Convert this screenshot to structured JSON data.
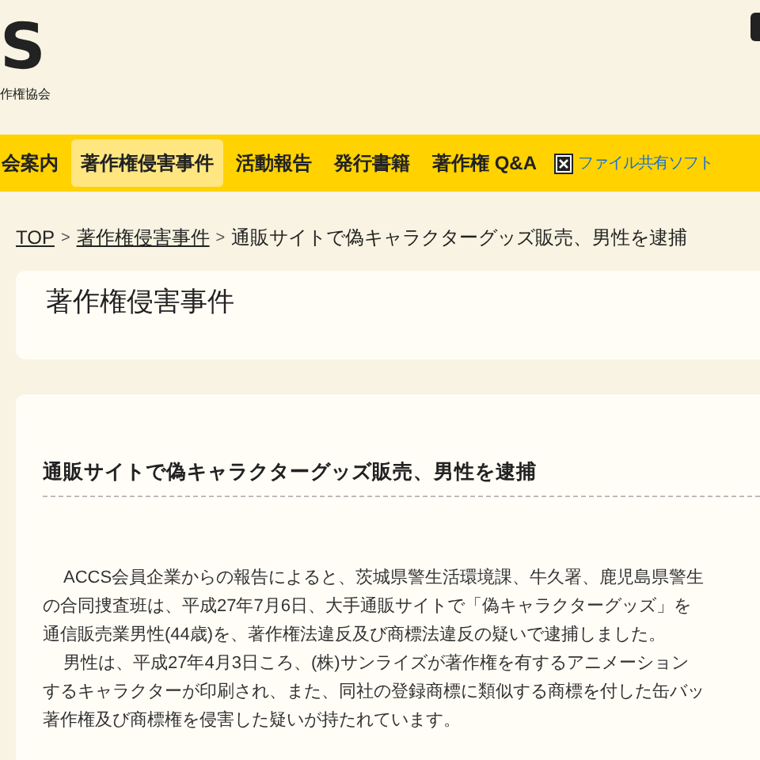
{
  "logo": {
    "mark": "S",
    "subtitle": "作権協会"
  },
  "nav": [
    {
      "label": "会案内",
      "selected": false,
      "kind": "text"
    },
    {
      "label": "著作権侵害事件",
      "selected": true,
      "kind": "text"
    },
    {
      "label": "活動報告",
      "selected": false,
      "kind": "text"
    },
    {
      "label": "発行書籍",
      "selected": false,
      "kind": "text"
    },
    {
      "label": "著作権 Q&A",
      "selected": false,
      "kind": "text"
    },
    {
      "label": "ファイル共有ソフト",
      "selected": false,
      "kind": "image-link"
    }
  ],
  "breadcrumb": [
    {
      "label": "TOP",
      "link": true
    },
    {
      "label": "著作権侵害事件",
      "link": true
    },
    {
      "label": "通販サイトで偽キャラクターグッズ販売、男性を逮捕",
      "link": false
    }
  ],
  "breadcrumb_separator": ">",
  "section_title": "著作権侵害事件",
  "article": {
    "title": "通販サイトで偽キャラクターグッズ販売、男性を逮捕",
    "lines": [
      {
        "text": "ACCS会員企業からの報告によると、茨城県警生活環境課、牛久署、鹿児島県警生",
        "indent": true
      },
      {
        "text": "の合同捜査班は、平成27年7月6日、大手通販サイトで「偽キャラクターグッズ」を",
        "indent": false
      },
      {
        "text": "通信販売業男性(44歳)を、著作権法違反及び商標法違反の疑いで逮捕しました。",
        "indent": false
      },
      {
        "text": "男性は、平成27年4月3日ころ、(株)サンライズが著作権を有するアニメーション",
        "indent": true
      },
      {
        "text": "するキャラクターが印刷され、また、同社の登録商標に類似する商標を付した缶バッ",
        "indent": false
      },
      {
        "text": "著作権及び商標権を侵害した疑いが持たれています。",
        "indent": false
      }
    ]
  }
}
